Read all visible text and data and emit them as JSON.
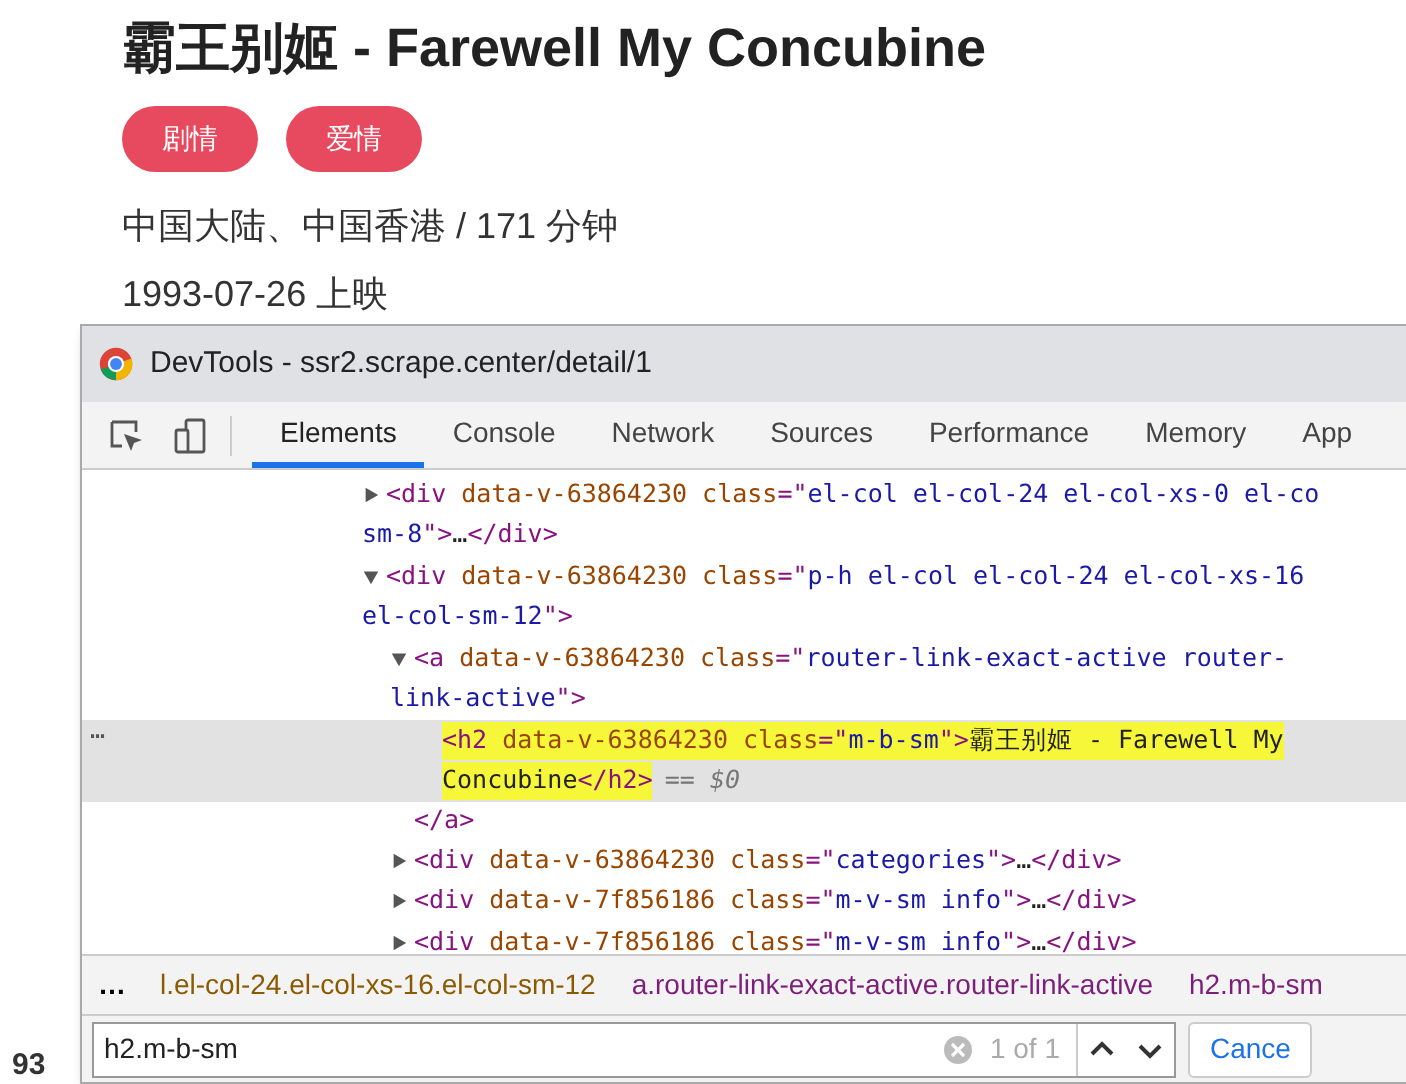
{
  "page": {
    "title": "霸王别姬 - Farewell My Concubine",
    "tags": [
      "剧情",
      "爱情"
    ],
    "info": [
      "中国大陆、中国香港 / 171 分钟",
      "1993-07-26 上映"
    ],
    "score": "93"
  },
  "devtools": {
    "title": "DevTools - ssr2.scrape.center/detail/1",
    "tabs": [
      {
        "label": "Elements",
        "selected": true
      },
      {
        "label": "Console",
        "selected": false
      },
      {
        "label": "Network",
        "selected": false
      },
      {
        "label": "Sources",
        "selected": false
      },
      {
        "label": "Performance",
        "selected": false
      },
      {
        "label": "Memory",
        "selected": false
      },
      {
        "label": "App",
        "selected": false
      }
    ],
    "nodes": [
      {
        "expanded": false,
        "lines": [
          [
            {
              "kind": "tag",
              "text": "<div"
            },
            {
              "kind": "attr",
              "text": " data-v-63864230"
            },
            {
              "kind": "attr",
              "text": " class"
            },
            {
              "kind": "tag",
              "text": "=\""
            },
            {
              "kind": "value",
              "text": "el-col el-col-24 el-col-xs-0 el-co"
            }
          ],
          [
            {
              "kind": "value",
              "text": "sm-8"
            },
            {
              "kind": "tag",
              "text": "\">"
            },
            {
              "kind": "text",
              "text": "…"
            },
            {
              "kind": "tag",
              "text": "</div>"
            }
          ]
        ]
      },
      {
        "expanded": true,
        "lines": [
          [
            {
              "kind": "tag",
              "text": "<div"
            },
            {
              "kind": "attr",
              "text": " data-v-63864230"
            },
            {
              "kind": "attr",
              "text": " class"
            },
            {
              "kind": "tag",
              "text": "=\""
            },
            {
              "kind": "value",
              "text": "p-h el-col el-col-24 el-col-xs-16"
            }
          ],
          [
            {
              "kind": "value",
              "text": "el-col-sm-12"
            },
            {
              "kind": "tag",
              "text": "\">"
            }
          ]
        ],
        "children": [
          {
            "expanded": true,
            "lines": [
              [
                {
                  "kind": "tag",
                  "text": "<a"
                },
                {
                  "kind": "attr",
                  "text": " data-v-63864230"
                },
                {
                  "kind": "attr",
                  "text": " class"
                },
                {
                  "kind": "tag",
                  "text": "=\""
                },
                {
                  "kind": "value",
                  "text": "router-link-exact-active router-"
                }
              ],
              [
                {
                  "kind": "value",
                  "text": "link-active"
                },
                {
                  "kind": "tag",
                  "text": "\">"
                }
              ]
            ],
            "children": [
              {
                "selected": true,
                "match": true,
                "lines": [
                  [
                    {
                      "kind": "tag",
                      "text": "<h2"
                    },
                    {
                      "kind": "attr",
                      "text": " data-v-63864230"
                    },
                    {
                      "kind": "attr",
                      "text": " class"
                    },
                    {
                      "kind": "tag",
                      "text": "=\""
                    },
                    {
                      "kind": "value",
                      "text": "m-b-sm"
                    },
                    {
                      "kind": "tag",
                      "text": "\">"
                    },
                    {
                      "kind": "text",
                      "text": "霸王别姬 - Farewell My"
                    }
                  ],
                  [
                    {
                      "kind": "text",
                      "text": "Concubine"
                    },
                    {
                      "kind": "tag",
                      "text": "</h2>"
                    }
                  ]
                ],
                "selected_marker": "== $0",
                "dots": "…"
              }
            ],
            "closing": "</a>"
          },
          {
            "expanded": false,
            "lines": [
              [
                {
                  "kind": "tag",
                  "text": "<div"
                },
                {
                  "kind": "attr",
                  "text": " data-v-63864230"
                },
                {
                  "kind": "attr",
                  "text": " class"
                },
                {
                  "kind": "tag",
                  "text": "=\""
                },
                {
                  "kind": "value",
                  "text": "categories"
                },
                {
                  "kind": "tag",
                  "text": "\">"
                },
                {
                  "kind": "text",
                  "text": "…"
                },
                {
                  "kind": "tag",
                  "text": "</div>"
                }
              ]
            ]
          },
          {
            "expanded": false,
            "lines": [
              [
                {
                  "kind": "tag",
                  "text": "<div"
                },
                {
                  "kind": "attr",
                  "text": " data-v-7f856186"
                },
                {
                  "kind": "attr",
                  "text": " class"
                },
                {
                  "kind": "tag",
                  "text": "=\""
                },
                {
                  "kind": "value",
                  "text": "m-v-sm info"
                },
                {
                  "kind": "tag",
                  "text": "\">"
                },
                {
                  "kind": "text",
                  "text": "…"
                },
                {
                  "kind": "tag",
                  "text": "</div>"
                }
              ]
            ]
          },
          {
            "expanded": false,
            "lines": [
              [
                {
                  "kind": "tag",
                  "text": "<div"
                },
                {
                  "kind": "attr",
                  "text": " data-v-7f856186"
                },
                {
                  "kind": "attr",
                  "text": " class"
                },
                {
                  "kind": "tag",
                  "text": "=\""
                },
                {
                  "kind": "value",
                  "text": "m-v-sm info"
                },
                {
                  "kind": "tag",
                  "text": "\">"
                },
                {
                  "kind": "text",
                  "text": "…"
                },
                {
                  "kind": "tag",
                  "text": "</div>"
                }
              ]
            ]
          }
        ]
      }
    ],
    "breadcrumbs": {
      "more": "…",
      "items": [
        "l.el-col-24.el-col-xs-16.el-col-sm-12",
        "a.router-link-exact-active.router-link-active",
        "h2.m-b-sm"
      ]
    },
    "search": {
      "value": "h2.m-b-sm",
      "count": "1 of 1",
      "cancel": "Cance"
    }
  }
}
